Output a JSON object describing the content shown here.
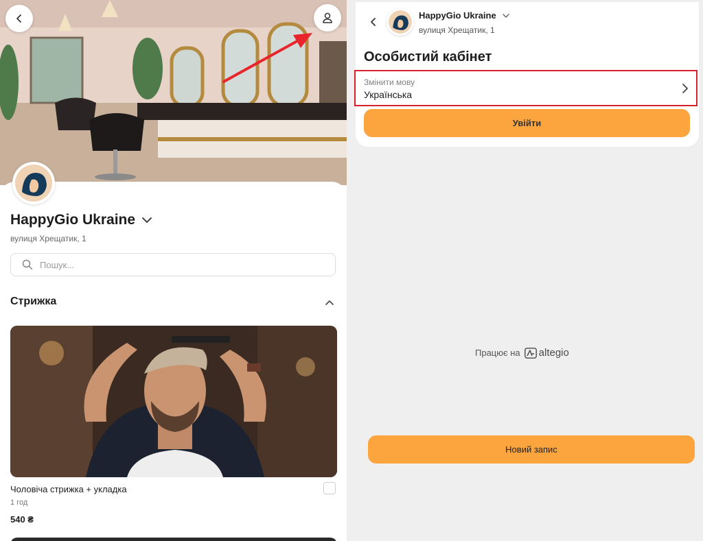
{
  "salon": {
    "name": "HappyGio Ukraine",
    "address": "вулиця Хрещатик, 1"
  },
  "search": {
    "placeholder": "Пошук..."
  },
  "category": {
    "title": "Стрижка"
  },
  "service": {
    "name": "Чоловіча стрижка + укладка",
    "duration": "1 год",
    "price": "540 ₴"
  },
  "account": {
    "title": "Особистий кабінет",
    "language_label": "Змінити мову",
    "language_value": "Українська",
    "login_label": "Увійти"
  },
  "footer": {
    "powered_by": "Працює на",
    "brand": "altegio",
    "new_booking_label": "Новий запис"
  },
  "icons": {
    "back": "chevron-left-icon",
    "profile": "user-icon",
    "search": "search-icon",
    "collapse": "chevron-up-icon",
    "dropdown": "chevron-down-icon",
    "forward": "chevron-right-icon",
    "annotation": "red-arrow"
  },
  "colors": {
    "accent": "#fca43d",
    "highlight_border": "#d6202b",
    "annotation_arrow": "#e8252b"
  }
}
